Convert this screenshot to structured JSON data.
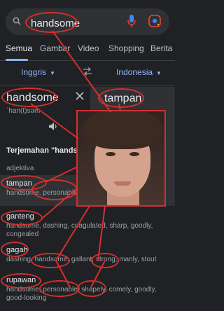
{
  "search": {
    "query": "handsome"
  },
  "tabs": [
    "Semua",
    "Gambar",
    "Video",
    "Shopping",
    "Berita"
  ],
  "translator": {
    "source_lang": "Inggris",
    "target_lang": "Indonesia",
    "source_word": "handsome",
    "phonetic": "ˈhan(t)səm",
    "target_word": "tampan"
  },
  "translations": {
    "title": "Terjemahan \"handsome\"",
    "pos": "adjektiva",
    "items": [
      {
        "word": "tampan",
        "synonyms": "handsome, personable, smart"
      },
      {
        "word": "ganteng",
        "synonyms": "handsome, dashing, coagulated, sharp, goodly, congealed"
      },
      {
        "word": "gagah",
        "synonyms": "dashing, handsome, gallant, strong, manly, stout"
      },
      {
        "word": "rupawan",
        "synonyms": "handsome, personable, shapely, comely, goodly, good-looking"
      }
    ]
  },
  "colors": {
    "accent": "#8ab4f8",
    "annotation": "#d32f2f",
    "background": "#202124",
    "surface": "#303134"
  },
  "icons": [
    "search-icon",
    "mic-icon",
    "lens-icon",
    "swap-icon",
    "close-icon",
    "speaker-icon"
  ]
}
